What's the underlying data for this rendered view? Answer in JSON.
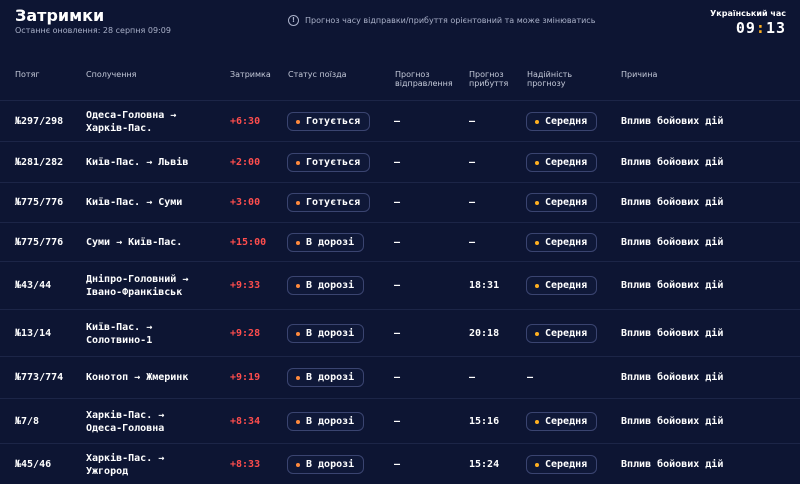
{
  "header": {
    "title": "Затримки",
    "updated": "Останнє оновлення: 28 серпня 09:09",
    "notice": "Прогноз часу відправки/прибуття орієнтовний та може змінюватись",
    "notice_icon": "info-icon",
    "clock_label": "Український час",
    "clock_hours": "09",
    "clock_minutes": "13"
  },
  "columns": {
    "train": "Потяг",
    "route": "Сполучення",
    "delay": "Затримка",
    "status": "Статус поїзда",
    "dep_l1": "Прогноз",
    "dep_l2": "відправлення",
    "arr_l1": "Прогноз",
    "arr_l2": "прибуття",
    "rel_l1": "Надійність",
    "rel_l2": "прогнозу",
    "reason": "Причина"
  },
  "colors": {
    "delay": "#ff4d4d",
    "dot": "#ff8a3d",
    "clock_colon": "#ffb020",
    "background": "#0d1533"
  },
  "rows": [
    {
      "train": "№297/298",
      "route_l1": "Одеса-Головна →",
      "route_l2": "Харків-Пас.",
      "delay": "+6:30",
      "status": "Готується",
      "dep": "—",
      "arr": "—",
      "reliability": "Середня",
      "reason": "Вплив бойових дій"
    },
    {
      "train": "№281/282",
      "route_l1": "Київ-Пас. → Львів",
      "route_l2": "",
      "delay": "+2:00",
      "status": "Готується",
      "dep": "—",
      "arr": "—",
      "reliability": "Середня",
      "reason": "Вплив бойових дій"
    },
    {
      "train": "№775/776",
      "route_l1": "Київ-Пас. → Суми",
      "route_l2": "",
      "delay": "+3:00",
      "status": "Готується",
      "dep": "—",
      "arr": "—",
      "reliability": "Середня",
      "reason": "Вплив бойових дій"
    },
    {
      "train": "№775/776",
      "route_l1": "Суми → Київ-Пас.",
      "route_l2": "",
      "delay": "+15:00",
      "status": "В дорозі",
      "dep": "—",
      "arr": "—",
      "reliability": "Середня",
      "reason": "Вплив бойових дій"
    },
    {
      "train": "№43/44",
      "route_l1": "Дніпро-Головний →",
      "route_l2": "Івано-Франківськ",
      "delay": "+9:33",
      "status": "В дорозі",
      "dep": "—",
      "arr": "18:31",
      "reliability": "Середня",
      "reason": "Вплив бойових дій"
    },
    {
      "train": "№13/14",
      "route_l1": "Київ-Пас. →",
      "route_l2": "Солотвино-1",
      "delay": "+9:28",
      "status": "В дорозі",
      "dep": "—",
      "arr": "20:18",
      "reliability": "Середня",
      "reason": "Вплив бойових дій"
    },
    {
      "train": "№773/774",
      "route_l1": "Конотоп → Жмеринк",
      "route_l2": "",
      "delay": "+9:19",
      "status": "В дорозі",
      "dep": "—",
      "arr": "—",
      "reliability": "—",
      "reason": "Вплив бойових дій"
    },
    {
      "train": "№7/8",
      "route_l1": "Харків-Пас. →",
      "route_l2": "Одеса-Головна",
      "delay": "+8:34",
      "status": "В дорозі",
      "dep": "—",
      "arr": "15:16",
      "reliability": "Середня",
      "reason": "Вплив бойових дій"
    },
    {
      "train": "№45/46",
      "route_l1": "Харків-Пас. →",
      "route_l2": "Ужгород",
      "delay": "+8:33",
      "status": "В дорозі",
      "dep": "—",
      "arr": "15:24",
      "reliability": "Середня",
      "reason": "Вплив бойових дій"
    }
  ]
}
